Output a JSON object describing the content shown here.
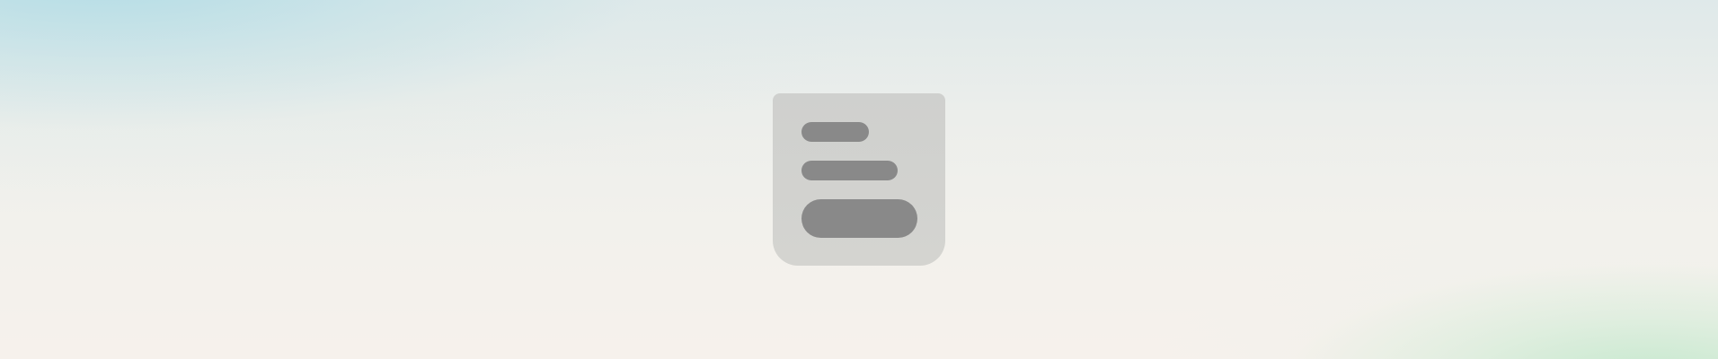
{
  "scene": {
    "type": "placeholder-illustration",
    "background_colors": {
      "top_left_tint": "#b0dce6",
      "bottom_right_tint": "#c2e8cc",
      "base": "#f1f2ee"
    }
  },
  "placeholder": {
    "icon": "document-text-lines-icon",
    "tile_color": "#d0d0ce",
    "bar_color": "#898989",
    "bars": [
      {
        "name": "short-line"
      },
      {
        "name": "medium-line"
      },
      {
        "name": "wide-pill"
      }
    ]
  }
}
